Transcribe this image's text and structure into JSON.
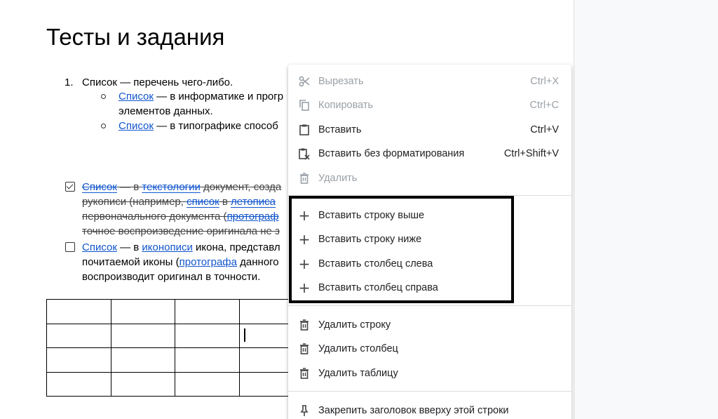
{
  "document": {
    "title": "Тесты и задания",
    "list_number": "1.",
    "item1": "Список — перечень чего-либо.",
    "sub1_link": "Список",
    "sub1_text": " — в информатике и прогр",
    "sub1_line2": "элементов данных.",
    "sub2_link": "Список",
    "sub2_text": " — в типографике способ",
    "check1": {
      "checked": true,
      "link1": "Список",
      "text1": " — в ",
      "link2": "текстологии",
      "text2": " документ, созда",
      "line2a": "рукописи (например, ",
      "line2_link": "список",
      "line2b": " в ",
      "line2_link2": "летописа",
      "line3a": "первоначального документа (",
      "line3_link": "протограф",
      "line4": "точное воспроизведение оригинала не з"
    },
    "check2": {
      "checked": false,
      "link1": "Список",
      "text1": " — в ",
      "link2": "иконописи",
      "text2": " икона, представл",
      "line2a": "почитаемой иконы (",
      "line2_link": "протографа",
      "line2b": " данного",
      "line3": "воспроизводит оригинал в точности."
    }
  },
  "context_menu": {
    "cut": {
      "label": "Вырезать",
      "shortcut": "Ctrl+X",
      "icon": "scissors-icon"
    },
    "copy": {
      "label": "Копировать",
      "shortcut": "Ctrl+C",
      "icon": "copy-icon"
    },
    "paste": {
      "label": "Вставить",
      "shortcut": "Ctrl+V",
      "icon": "clipboard-icon"
    },
    "paste_plain": {
      "label": "Вставить без форматирования",
      "shortcut": "Ctrl+Shift+V",
      "icon": "clipboard-plain-icon"
    },
    "delete": {
      "label": "Удалить",
      "icon": "trash-icon"
    },
    "insert_row_above": {
      "label": "Вставить строку выше",
      "icon": "plus-icon"
    },
    "insert_row_below": {
      "label": "Вставить строку ниже",
      "icon": "plus-icon"
    },
    "insert_col_left": {
      "label": "Вставить столбец слева",
      "icon": "plus-icon"
    },
    "insert_col_right": {
      "label": "Вставить столбец справа",
      "icon": "plus-icon"
    },
    "delete_row": {
      "label": "Удалить строку",
      "icon": "trash-icon"
    },
    "delete_column": {
      "label": "Удалить столбец",
      "icon": "trash-icon"
    },
    "delete_table": {
      "label": "Удалить таблицу",
      "icon": "trash-icon"
    },
    "pin_header": {
      "label": "Закрепить заголовок вверху этой строки",
      "icon": "pin-icon"
    }
  },
  "colors": {
    "link": "#1155cc",
    "disabled_text": "#9aa0a6",
    "highlight_border": "#000000"
  }
}
